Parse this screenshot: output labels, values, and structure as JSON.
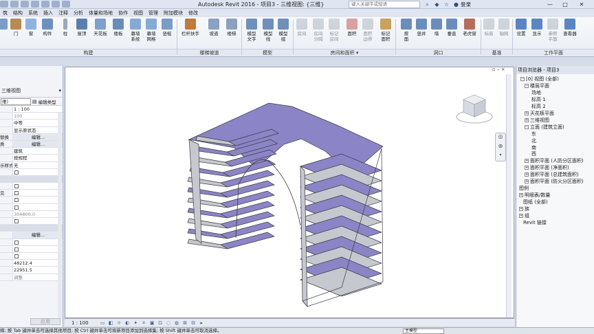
{
  "title_bar": {
    "app_title": "Autodesk Revit 2016 -   项目3 - 三维视图: {三维}",
    "search_placeholder": "键入关键字或短语",
    "login_label": "登录",
    "minimize": "—",
    "maximize": "□",
    "close": "✕"
  },
  "tabs": [
    {
      "label": "筑"
    },
    {
      "label": "结构"
    },
    {
      "label": "系统"
    },
    {
      "label": "插入"
    },
    {
      "label": "注释"
    },
    {
      "label": "分析"
    },
    {
      "label": "体量和场地"
    },
    {
      "label": "协作"
    },
    {
      "label": "视图"
    },
    {
      "label": "管理"
    },
    {
      "label": "附加模块"
    },
    {
      "label": "修改"
    }
  ],
  "ribbon": {
    "buttons": {
      "door": "门",
      "window": "窗",
      "component": "构件",
      "column": "柱",
      "roof": "屋顶",
      "ceiling": "天花板",
      "floor": "楼板",
      "curtain_system": "幕墙\n系统",
      "curtain_grid": "幕墙\n网格",
      "mullion": "竖梃",
      "railing": "栏杆扶手",
      "ramp": "坡道",
      "stair": "楼梯",
      "model_text": "模型\n文字",
      "model_line": "模型\n线",
      "model_group": "模型\n组",
      "room": "房间",
      "room_separator": "房间\n分隔",
      "tag_room": "标记\n房间",
      "area": "面积",
      "area_boundary": "面积\n边界",
      "tag_area": "标记\n面积",
      "by_face": "按\n面",
      "shaft": "竖井",
      "wall": "墙",
      "vertical": "垂直",
      "dormer": "老虎窗",
      "level": "标高",
      "grid": "轴网",
      "set": "设置",
      "show": "显示",
      "ref_plane": "参照\n平面",
      "viewer": "查看器"
    },
    "groups": {
      "build": "构建",
      "circulation": "楼梯坡道",
      "model": "模型",
      "room_area": "房间和面积 ▾",
      "opening": "洞口",
      "datum": "基准",
      "work_plane": "工作平面"
    }
  },
  "properties": {
    "type_name": "三维视图",
    "type_selector": "维)",
    "edit_type": "编辑类型",
    "rows": [
      {
        "k": "",
        "v": "1 : 100"
      },
      {
        "k": "",
        "v": "100",
        "grey": true
      },
      {
        "k": "",
        "v": "中等"
      },
      {
        "k": "",
        "v": "显示原状态"
      },
      {
        "k": "替换",
        "v": "编辑...",
        "btn": true
      },
      {
        "k": "质",
        "v": "编辑...",
        "btn": true
      },
      {
        "k": "",
        "v": "建筑"
      },
      {
        "k": "",
        "v": "按规程"
      },
      {
        "k": "示样式",
        "v": "无"
      },
      {
        "k": "",
        "v": "",
        "chk": true
      },
      {
        "k": "",
        "v": "",
        "head": true
      },
      {
        "k": "",
        "v": "",
        "chk": true
      },
      {
        "k": "见",
        "v": "",
        "chk": true
      },
      {
        "k": "",
        "v": "",
        "chk": true
      },
      {
        "k": "",
        "v": "",
        "chk": true
      },
      {
        "k": "",
        "v": "304800.0",
        "grey": true
      },
      {
        "k": "",
        "v": "",
        "chk": true
      },
      {
        "k": "",
        "v": "",
        "head": true
      },
      {
        "k": "",
        "v": "编辑...",
        "btn": true
      },
      {
        "k": "",
        "v": "",
        "chk": true
      },
      {
        "k": "",
        "v": "",
        "chk": true
      },
      {
        "k": "",
        "v": "",
        "chk": true
      },
      {
        "k": "",
        "v": "48212.4"
      },
      {
        "k": "",
        "v": "22951.5"
      },
      {
        "k": "",
        "v": "调整",
        "grey": true
      }
    ],
    "apply_button": "应用"
  },
  "view_bar": {
    "scale": "1 : 100"
  },
  "project_browser": {
    "title": "项目浏览器 - 项目3",
    "nodes": [
      {
        "label": "[0] 视图 (全部)",
        "exp": "−"
      },
      {
        "label": "楼层平面",
        "exp": "−"
      },
      {
        "label": "场地"
      },
      {
        "label": "标高 1"
      },
      {
        "label": "标高 2"
      },
      {
        "label": "天花板平面",
        "exp": "+"
      },
      {
        "label": "三维视图",
        "exp": "+"
      },
      {
        "label": "立面 (建筑立面)",
        "exp": "−"
      },
      {
        "label": "东"
      },
      {
        "label": "北"
      },
      {
        "label": "南"
      },
      {
        "label": "西"
      },
      {
        "label": "面积平面 (人防分区面积)",
        "exp": "+"
      },
      {
        "label": "面积平面 (净面积)",
        "exp": "+"
      },
      {
        "label": "面积平面 (总建筑面积)",
        "exp": "+"
      },
      {
        "label": "面积平面 (防火分区面积)",
        "exp": "+"
      },
      {
        "label": "图例"
      },
      {
        "label": "明细表/数量",
        "exp": "+"
      },
      {
        "label": "图纸 (全部)"
      },
      {
        "label": "族",
        "exp": "+"
      },
      {
        "label": "组",
        "exp": "+"
      },
      {
        "label": "Revit 链接"
      }
    ]
  },
  "status_bar": {
    "text": "择; 按 Tab 键并单击可选择其他项目; 按 Ctrl 键并单击可将新项目添加到选择集; 按 Shift 键并单击可取消选择。",
    "model_label": "主模型"
  },
  "colors": {
    "surface": "#8b84c6",
    "surface_light": "#c6c8cf",
    "edge": "#3b3b3b",
    "accent": "#2f4f7f"
  }
}
